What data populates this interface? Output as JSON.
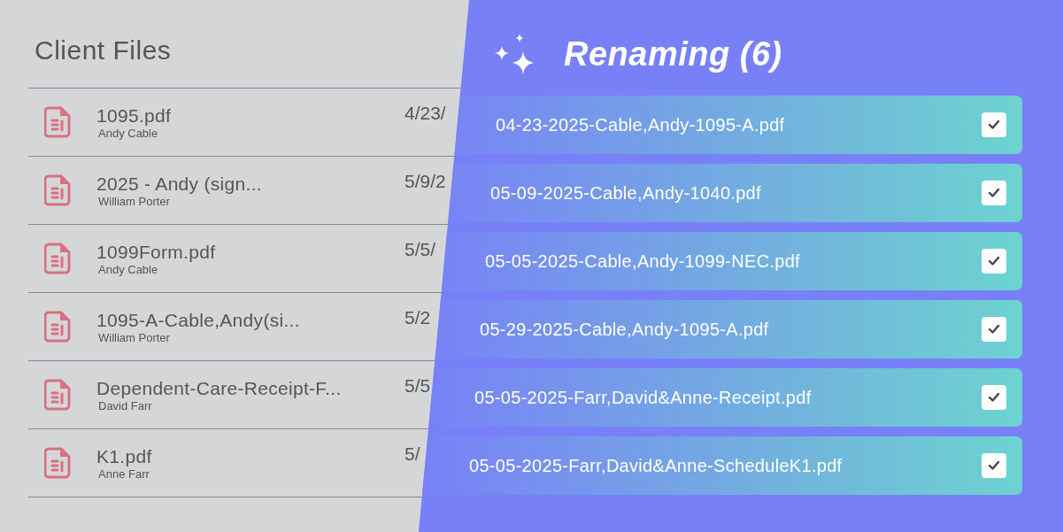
{
  "files_panel": {
    "title": "Client Files",
    "files": [
      {
        "name": "1095.pdf",
        "owner": "Andy Cable",
        "date": "4/23/"
      },
      {
        "name": "2025 - Andy (sign...",
        "owner": "William Porter",
        "date": "5/9/2"
      },
      {
        "name": "1099Form.pdf",
        "owner": "Andy Cable",
        "date": "5/5/"
      },
      {
        "name": "1095-A-Cable,Andy(si...",
        "owner": "William Porter",
        "date": "5/2"
      },
      {
        "name": "Dependent-Care-Receipt-F...",
        "owner": "David Farr",
        "date": "5/5"
      },
      {
        "name": "K1.pdf",
        "owner": "Anne Farr",
        "date": "5/"
      }
    ]
  },
  "renaming_panel": {
    "title": "Renaming (6)",
    "items": [
      {
        "name": "04-23-2025-Cable,Andy-1095-A.pdf",
        "checked": true
      },
      {
        "name": "05-09-2025-Cable,Andy-1040.pdf",
        "checked": true
      },
      {
        "name": "05-05-2025-Cable,Andy-1099-NEC.pdf",
        "checked": true
      },
      {
        "name": "05-29-2025-Cable,Andy-1095-A.pdf",
        "checked": true
      },
      {
        "name": "05-05-2025-Farr,David&Anne-Receipt.pdf",
        "checked": true
      },
      {
        "name": "05-05-2025-Farr,David&Anne-ScheduleK1.pdf",
        "checked": true
      }
    ]
  }
}
